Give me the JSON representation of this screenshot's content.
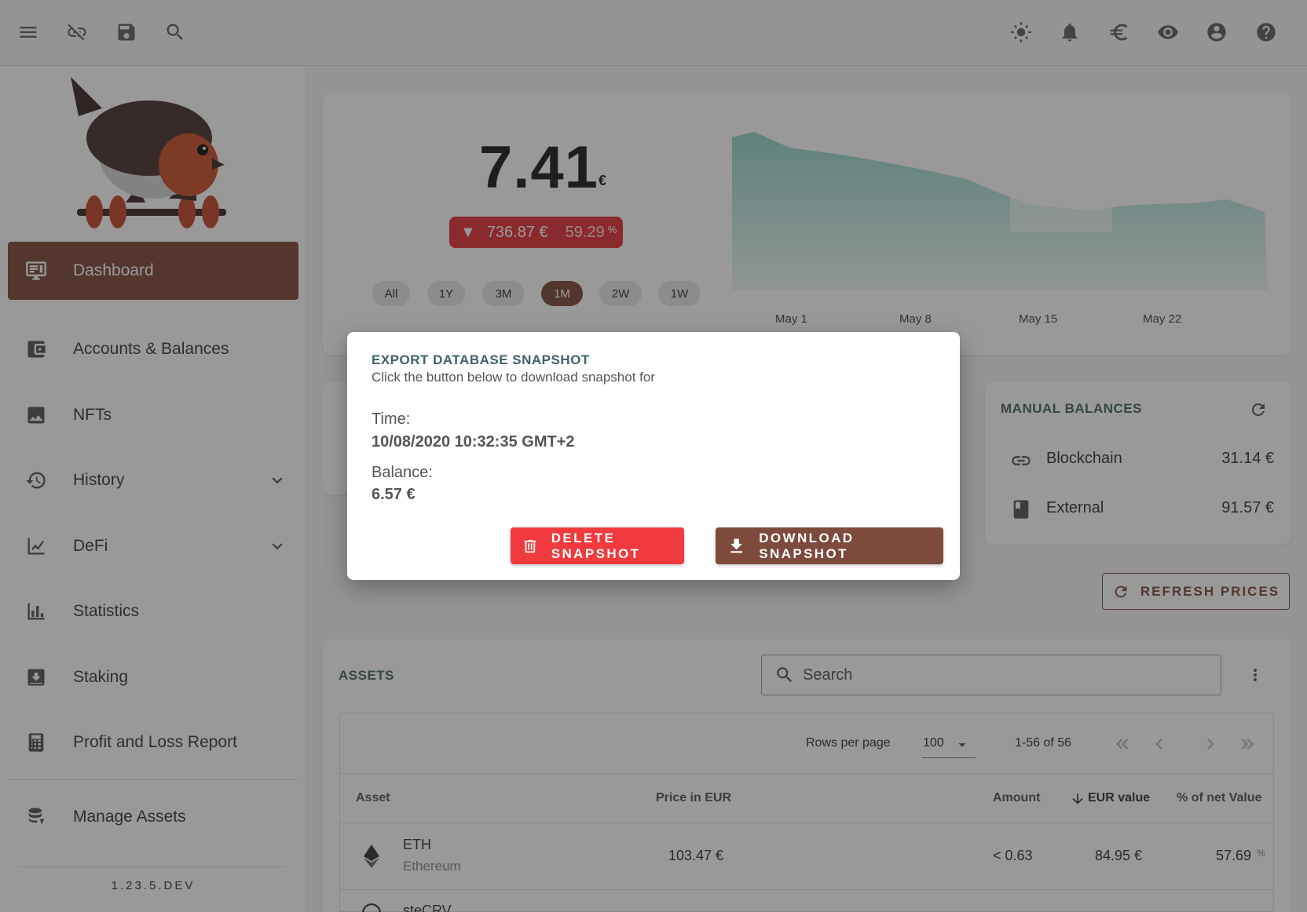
{
  "topbar": {
    "left_icons": [
      "menu-icon",
      "link-off-icon",
      "save-icon",
      "search-icon"
    ],
    "right_icons": [
      "theme-sun-icon",
      "notification-bell-icon",
      "currency-euro-icon",
      "visibility-eye-icon",
      "account-circle-icon",
      "help-icon"
    ]
  },
  "sidebar": {
    "items": [
      {
        "label": "Dashboard",
        "icon": "dashboard-monitor-icon",
        "active": true
      },
      {
        "label": "Accounts & Balances",
        "icon": "wallet-icon"
      },
      {
        "label": "NFTs",
        "icon": "image-icon"
      },
      {
        "label": "History",
        "icon": "history-icon",
        "expandable": true
      },
      {
        "label": "DeFi",
        "icon": "defi-chart-icon",
        "expandable": true
      },
      {
        "label": "Statistics",
        "icon": "bar-chart-icon"
      },
      {
        "label": "Staking",
        "icon": "staking-inbox-icon"
      },
      {
        "label": "Profit and Loss Report",
        "icon": "calculator-icon"
      },
      {
        "label": "Manage Assets",
        "icon": "coins-stack-icon"
      }
    ],
    "version": "1.23.5.DEV"
  },
  "overview": {
    "net_value": "7.41",
    "currency_symbol": "€",
    "change_amount": "736.87 €",
    "change_percent": "59.29",
    "percent_symbol": "%",
    "change_direction_glyph": "▼",
    "periods": [
      "All",
      "1Y",
      "3M",
      "1M",
      "2W",
      "1W"
    ],
    "active_period": "1M",
    "chart_x_labels": [
      "May 1",
      "May 8",
      "May 15",
      "May 22"
    ],
    "accent_color": "#7e4a3b",
    "negative_color": "#e53238",
    "chart_fill_color": "#8fd3c7"
  },
  "manual_balances": {
    "title": "MANUAL BALANCES",
    "rows": [
      {
        "label": "Blockchain",
        "value": "31.14 €",
        "icon": "link-icon"
      },
      {
        "label": "External",
        "value": "91.57 €",
        "icon": "book-icon"
      }
    ]
  },
  "refresh_button": {
    "label": "REFRESH PRICES"
  },
  "assets": {
    "title": "ASSETS",
    "search_placeholder": "Search",
    "rows_per_page_label": "Rows per page",
    "rows_per_page_value": "100",
    "range_text": "1-56 of 56",
    "columns": [
      "Asset",
      "Price in EUR",
      "Amount",
      "EUR value",
      "% of net Value"
    ],
    "rows": [
      {
        "symbol": "ETH",
        "name": "Ethereum",
        "price": "103.47 €",
        "amount": "< 0.63",
        "value": "84.95 €",
        "percent": "57.69",
        "percent_symbol": "%"
      },
      {
        "symbol": "steCRV",
        "name": "",
        "price": "",
        "amount": "",
        "value": "",
        "percent": ""
      }
    ]
  },
  "dialog": {
    "title": "EXPORT DATABASE SNAPSHOT",
    "subtitle": "Click the button below to download snapshot for",
    "time_label": "Time:",
    "time_value": "10/08/2020 10:32:35 GMT+2",
    "balance_label": "Balance:",
    "balance_value": "6.57 €",
    "delete_label": "DELETE SNAPSHOT",
    "download_label": "DOWNLOAD SNAPSHOT"
  }
}
